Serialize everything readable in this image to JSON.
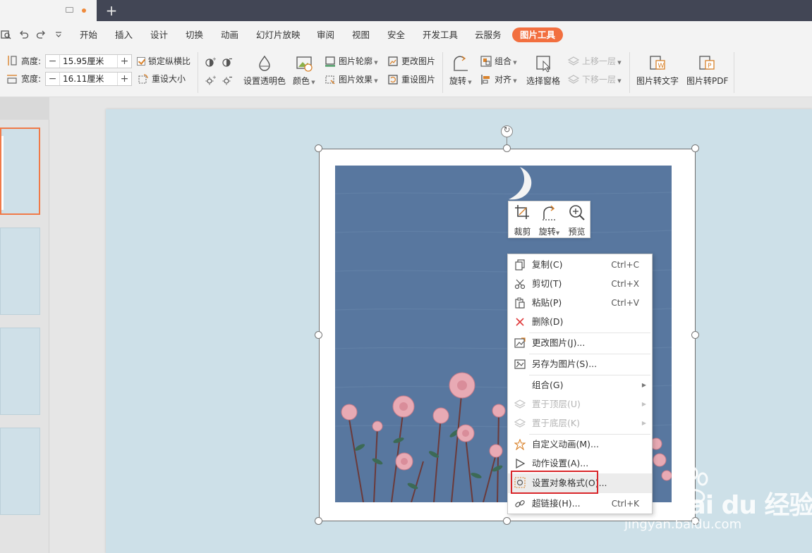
{
  "titlebar": {
    "new_tab": "+"
  },
  "menu": {
    "items": [
      "开始",
      "插入",
      "设计",
      "切换",
      "动画",
      "幻灯片放映",
      "审阅",
      "视图",
      "安全",
      "开发工具",
      "云服务"
    ],
    "active_tab": "图片工具"
  },
  "ribbon": {
    "height_label": "高度:",
    "height_value": "15.95厘米",
    "width_label": "宽度:",
    "width_value": "16.11厘米",
    "lock_ratio": "锁定纵横比",
    "reset_size": "重设大小",
    "set_transparent": "设置透明色",
    "color": "颜色",
    "outline": "图片轮廓",
    "effect": "图片效果",
    "change_pic": "更改图片",
    "reset_pic": "重设图片",
    "rotate": "旋转",
    "group": "组合",
    "align": "对齐",
    "selection_pane": "选择窗格",
    "bring_forward": "上移一层",
    "send_backward": "下移一层",
    "to_text": "图片转文字",
    "to_pdf": "图片转PDF"
  },
  "float_toolbar": {
    "crop": "裁剪",
    "rotate": "旋转",
    "preview": "预览"
  },
  "context_menu": {
    "copy": "复制(C)",
    "copy_sc": "Ctrl+C",
    "cut": "剪切(T)",
    "cut_sc": "Ctrl+X",
    "paste": "粘贴(P)",
    "paste_sc": "Ctrl+V",
    "delete": "删除(D)",
    "change_pic": "更改图片(J)...",
    "save_as": "另存为图片(S)...",
    "group": "组合(G)",
    "to_top": "置于顶层(U)",
    "to_bottom": "置于底层(K)",
    "custom_anim": "自定义动画(M)...",
    "action": "动作设置(A)...",
    "format_object": "设置对象格式(O)...",
    "hyperlink": "超链接(H)...",
    "hyperlink_sc": "Ctrl+K"
  },
  "watermark": {
    "brand": "Bai du 经验",
    "url": "jingyan.baidu.com"
  },
  "colors": {
    "accent": "#f26f3f",
    "highlight": "#d9262a",
    "slide_bg": "#cde0e8",
    "picture_bg": "#58779f"
  }
}
